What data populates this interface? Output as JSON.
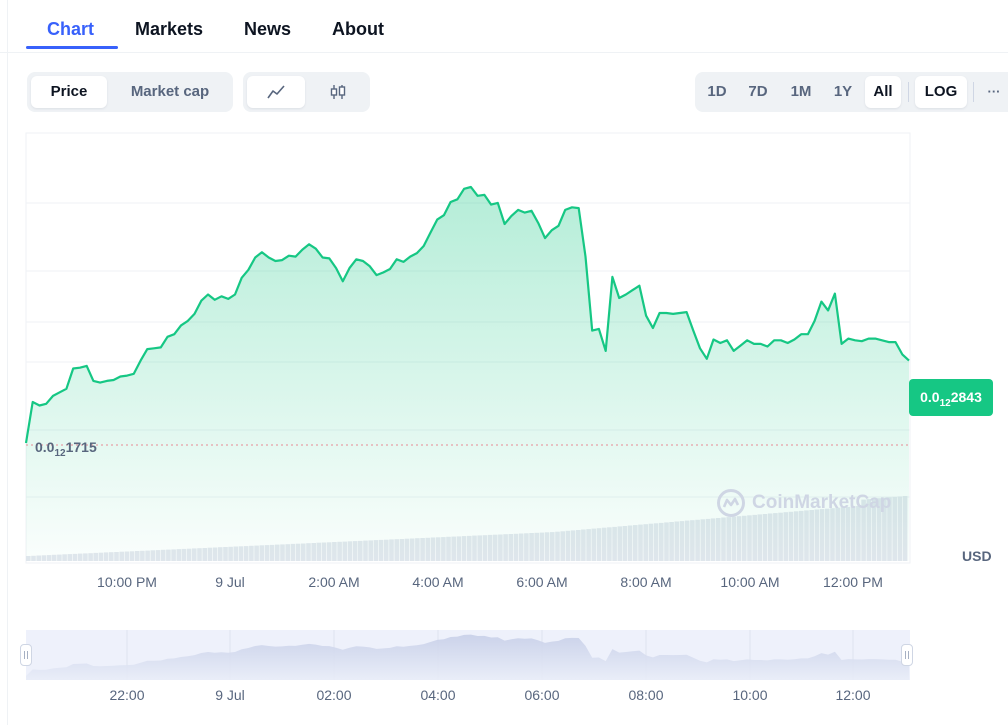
{
  "tabs": [
    {
      "label": "Chart",
      "active": true
    },
    {
      "label": "Markets",
      "active": false
    },
    {
      "label": "News",
      "active": false
    },
    {
      "label": "About",
      "active": false
    }
  ],
  "metric_toggle": {
    "price": "Price",
    "market_cap": "Market cap",
    "selected": "Price"
  },
  "chart_type_toggle": {
    "selected": "line",
    "icons": [
      "line-chart-icon",
      "candlestick-icon"
    ]
  },
  "ranges": {
    "items": [
      "1D",
      "7D",
      "1M",
      "1Y",
      "All"
    ],
    "selected": "All",
    "log": "LOG",
    "more": "···"
  },
  "price_badge": {
    "prefix": "0.0",
    "sub": "12",
    "digits": "2843"
  },
  "low_label": {
    "prefix": "0.0",
    "sub": "12",
    "digits": "1715"
  },
  "currency": "USD",
  "watermark": "CoinMarketCap",
  "colors": {
    "accent": "#3861fb",
    "up": "#16c784",
    "text": "#0d1421",
    "muted": "#58667e",
    "bg_soft": "#eff2f5"
  },
  "chart_data": {
    "type": "area",
    "x_ticks": [
      "10:00 PM",
      "9 Jul",
      "2:00 AM",
      "4:00 AM",
      "6:00 AM",
      "8:00 AM",
      "10:00 AM",
      "12:00 PM"
    ],
    "navigator_ticks": [
      "22:00",
      "9 Jul",
      "02:00",
      "04:00",
      "06:00",
      "08:00",
      "10:00",
      "12:00"
    ],
    "series": [
      {
        "values": [
          1715,
          2180,
          2140,
          2160,
          2250,
          2290,
          2330,
          2560,
          2570,
          2590,
          2420,
          2400,
          2420,
          2430,
          2470,
          2480,
          2500,
          2650,
          2780,
          2790,
          2800,
          2920,
          2950,
          3050,
          3100,
          3180,
          3330,
          3400,
          3340,
          3380,
          3350,
          3400,
          3590,
          3680,
          3820,
          3880,
          3820,
          3780,
          3790,
          3840,
          3830,
          3910,
          3970,
          3920,
          3820,
          3810,
          3700,
          3550,
          3700,
          3800,
          3780,
          3720,
          3620,
          3650,
          3690,
          3800,
          3770,
          3830,
          3870,
          3950,
          4100,
          4250,
          4300,
          4450,
          4480,
          4600,
          4620,
          4520,
          4530,
          4420,
          4440,
          4200,
          4290,
          4360,
          4330,
          4350,
          4210,
          4040,
          4130,
          4180,
          4360,
          4390,
          4380,
          3830,
          2990,
          3010,
          2760,
          3600,
          3360,
          3400,
          3450,
          3500,
          3160,
          3020,
          3190,
          3190,
          3180,
          3190,
          3200,
          2990,
          2790,
          2670,
          2890,
          2850,
          2880,
          2760,
          2820,
          2880,
          2840,
          2840,
          2810,
          2880,
          2880,
          2850,
          2890,
          2950,
          2950,
          3100,
          3320,
          3220,
          3410,
          2840,
          2900,
          2880,
          2870,
          2900,
          2900,
          2880,
          2860,
          2860,
          2720,
          2650
        ],
        "note_unit": "0.0₁₂ digits"
      }
    ],
    "ylim": [
      1715,
      4620
    ],
    "baseline_label": "0.0₁₂1715",
    "last_label": "0.0₁₂2843",
    "grid": true,
    "volume": true
  }
}
